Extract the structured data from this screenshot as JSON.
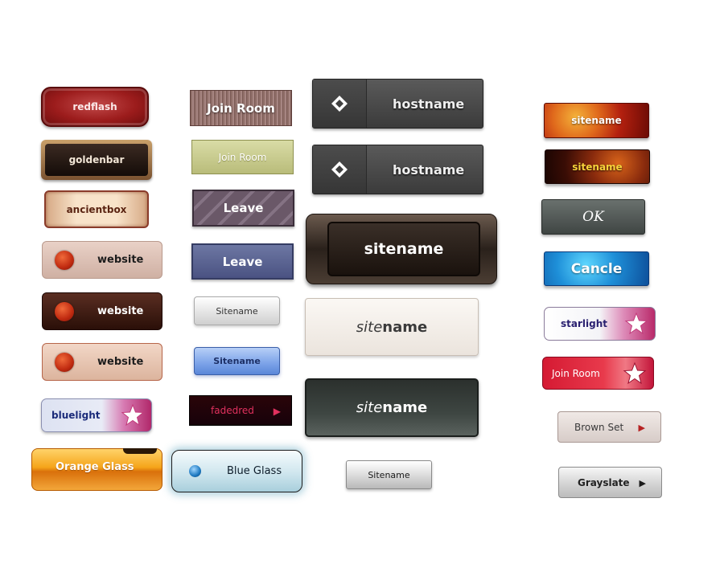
{
  "buttons": {
    "redflash": "redflash",
    "goldenbar": "goldenbar",
    "ancientbox": "ancientbox",
    "website_1": "website",
    "website_2": "website",
    "website_3": "website",
    "bluelight": "bluelight",
    "orange_glass": "Orange Glass",
    "join_room_1": "Join Room",
    "join_room_2": "Join Room",
    "leave_1": "Leave",
    "leave_2": "Leave",
    "sitename_white": "Sitename",
    "sitename_blue": "Sitename",
    "fadedred": "fadedred",
    "blue_glass": "Blue Glass",
    "hostname_1": "hostname",
    "hostname_2": "hostname",
    "sitename_dark": "sitename",
    "sitename_cream_site": "site",
    "sitename_cream_name": "name",
    "sitename_slate_site": "site",
    "sitename_slate_name": "name",
    "sitename_small": "Sitename",
    "sitename_fire_1": "sitename",
    "sitename_fire_2": "sitename",
    "ok": "OK",
    "cancle": "Cancle",
    "starlight": "starlight",
    "join_room_red": "Join Room",
    "brown_set": "Brown Set",
    "grayslate": "Grayslate"
  },
  "icons": {
    "diamond": "diamond-icon",
    "play_arrow": "play-arrow-icon",
    "star": "star-icon",
    "orb": "orb-icon"
  }
}
